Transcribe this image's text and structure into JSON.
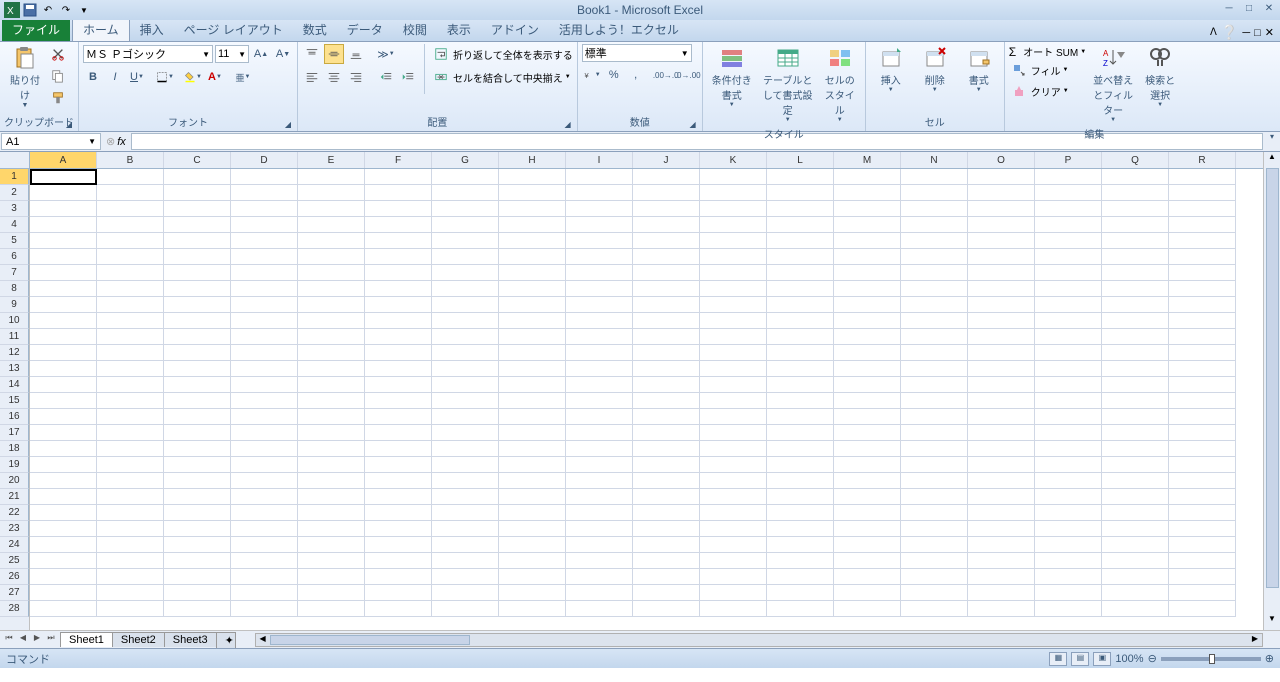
{
  "title": "Book1 - Microsoft Excel",
  "tabs": {
    "file": "ファイル",
    "home": "ホーム",
    "insert": "挿入",
    "layout": "ページ レイアウト",
    "formulas": "数式",
    "data": "データ",
    "review": "校閲",
    "view": "表示",
    "addins": "アドイン",
    "use": "活用しよう！エクセル"
  },
  "groups": {
    "clipboard": "クリップボード",
    "font": "フォント",
    "alignment": "配置",
    "number": "数値",
    "styles": "スタイル",
    "cells": "セル",
    "editing": "編集"
  },
  "clipboard": {
    "paste": "貼り付け"
  },
  "font": {
    "name": "ＭＳ Ｐゴシック",
    "size": "11"
  },
  "alignment": {
    "wrap": "折り返して全体を表示する",
    "merge": "セルを結合して中央揃え"
  },
  "number": {
    "format": "標準"
  },
  "styles": {
    "conditional": "条件付き書式",
    "table": "テーブルとして書式設定",
    "cell": "セルのスタイル"
  },
  "cells_grp": {
    "insert": "挿入",
    "delete": "削除",
    "format": "書式"
  },
  "editing": {
    "autosum": "オート SUM",
    "fill": "フィル",
    "clear": "クリア",
    "sort": "並べ替えとフィルター",
    "find": "検索と選択"
  },
  "namebox": "A1",
  "columns": [
    "A",
    "B",
    "C",
    "D",
    "E",
    "F",
    "G",
    "H",
    "I",
    "J",
    "K",
    "L",
    "M",
    "N",
    "O",
    "P",
    "Q",
    "R"
  ],
  "rows": [
    1,
    2,
    3,
    4,
    5,
    6,
    7,
    8,
    9,
    10,
    11,
    12,
    13,
    14,
    15,
    16,
    17,
    18,
    19,
    20,
    21,
    22,
    23,
    24,
    25,
    26,
    27,
    28
  ],
  "sheets": {
    "s1": "Sheet1",
    "s2": "Sheet2",
    "s3": "Sheet3"
  },
  "status": "コマンド",
  "zoom": "100%"
}
